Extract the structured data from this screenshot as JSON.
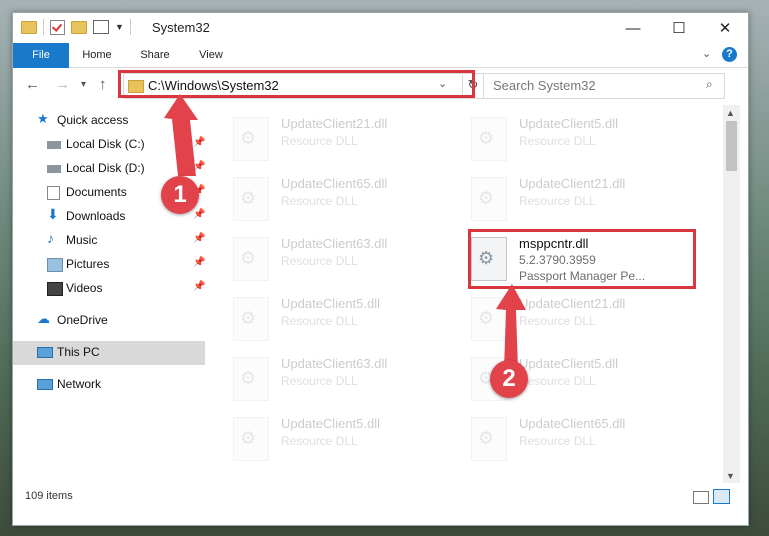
{
  "window": {
    "title": "System32"
  },
  "ribbon": {
    "tabs": [
      "File",
      "Home",
      "Share",
      "View"
    ],
    "help_label": "?"
  },
  "nav": {
    "back": "←",
    "forward": "→",
    "recent": "▾",
    "up": "↑"
  },
  "address": {
    "path": "C:\\Windows\\System32",
    "refresh": "↻"
  },
  "search": {
    "placeholder": "Search System32",
    "icon": "search-icon"
  },
  "sidebar": {
    "items": [
      {
        "label": "Quick access",
        "icon": "star-icon",
        "pinned": false
      },
      {
        "label": "Local Disk (C:)",
        "icon": "drive-icon",
        "pinned": true
      },
      {
        "label": "Local Disk (D:)",
        "icon": "drive-icon",
        "pinned": true
      },
      {
        "label": "Documents",
        "icon": "documents-icon",
        "pinned": true
      },
      {
        "label": "Downloads",
        "icon": "download-icon",
        "pinned": true
      },
      {
        "label": "Music",
        "icon": "music-icon",
        "pinned": true
      },
      {
        "label": "Pictures",
        "icon": "pictures-icon",
        "pinned": true
      },
      {
        "label": "Videos",
        "icon": "videos-icon",
        "pinned": true
      },
      {
        "label": "OneDrive",
        "icon": "cloud-icon",
        "pinned": false
      },
      {
        "label": "This PC",
        "icon": "computer-icon",
        "pinned": false
      },
      {
        "label": "Network",
        "icon": "network-icon",
        "pinned": false
      }
    ]
  },
  "files": [
    {
      "name": "UpdateClient21.dll",
      "type": "Resource DLL"
    },
    {
      "name": "UpdateClient5.dll",
      "type": "Resource DLL"
    },
    {
      "name": "UpdateClient65.dll",
      "type": "Resource DLL"
    },
    {
      "name": "UpdateClient21.dll",
      "type": "Resource DLL"
    },
    {
      "name": "UpdateClient63.dll",
      "type": "Resource DLL"
    },
    {
      "name": "msppcntr.dll",
      "version": "5.2.3790.3959",
      "type": "Passport Manager Pe..."
    },
    {
      "name": "UpdateClient5.dll",
      "type": "Resource DLL"
    },
    {
      "name": "UpdateClient21.dll",
      "type": "Resource DLL"
    },
    {
      "name": "UpdateClient63.dll",
      "type": "Resource DLL"
    },
    {
      "name": "UpdateClient5.dll",
      "type": "Resource DLL"
    },
    {
      "name": "UpdateClient5.dll",
      "type": "Resource DLL"
    },
    {
      "name": "UpdateClient65.dll",
      "type": "Resource DLL"
    }
  ],
  "status": {
    "item_count": "109 items"
  },
  "annotations": {
    "step1": "1",
    "step2": "2"
  },
  "colors": {
    "accent": "#1979ca",
    "highlight": "#d9363e"
  }
}
